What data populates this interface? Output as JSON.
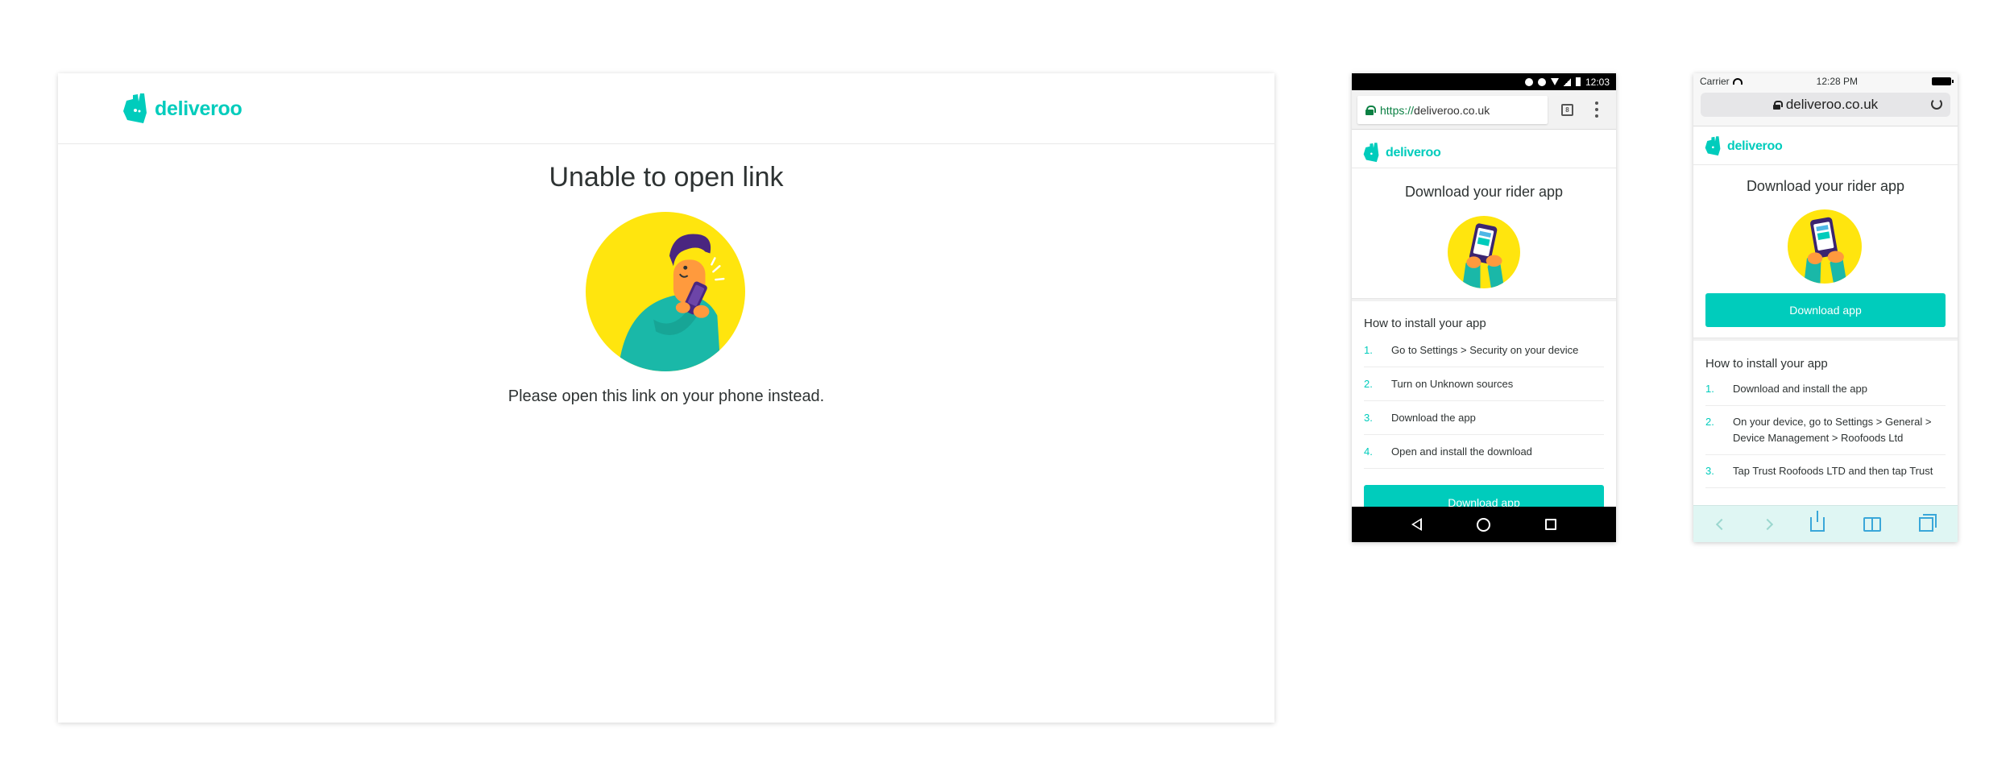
{
  "brand": {
    "name": "deliveroo",
    "color": "#00ccbc",
    "accent_yellow": "#ffe50e"
  },
  "desktop": {
    "title": "Unable to open link",
    "message": "Please open this link on your phone instead."
  },
  "android": {
    "status_time": "12:03",
    "url_scheme": "https://",
    "url_host": "deliveroo.co.uk",
    "tab_count": "8",
    "title": "Download your rider app",
    "howto_title": "How to install your app",
    "steps": [
      {
        "num": "1.",
        "text": "Go to Settings > Security on your device"
      },
      {
        "num": "2.",
        "text": "Turn on Unknown sources"
      },
      {
        "num": "3.",
        "text": "Download the app"
      },
      {
        "num": "4.",
        "text": "Open and install the download"
      }
    ],
    "button_label": "Download app"
  },
  "iphone": {
    "carrier": "Carrier",
    "status_time": "12:28 PM",
    "url": "deliveroo.co.uk",
    "title": "Download your rider app",
    "button_label": "Download app",
    "howto_title": "How to install your app",
    "steps": [
      {
        "num": "1.",
        "text": "Download and install the app"
      },
      {
        "num": "2.",
        "text": "On your device, go to Settings > General > Device Management > Roofoods Ltd"
      },
      {
        "num": "3.",
        "text": "Tap Trust Roofoods LTD and then tap Trust"
      }
    ]
  },
  "icons": [
    "deliveroo-kangaroo-icon",
    "lock-icon",
    "tabs-icon",
    "overflow-menu-icon",
    "nav-back-icon",
    "nav-home-icon",
    "nav-recents-icon",
    "wifi-icon",
    "battery-icon",
    "reload-icon",
    "back-chevron-icon",
    "forward-chevron-icon",
    "share-icon",
    "bookmarks-icon",
    "tabs-overview-icon"
  ]
}
